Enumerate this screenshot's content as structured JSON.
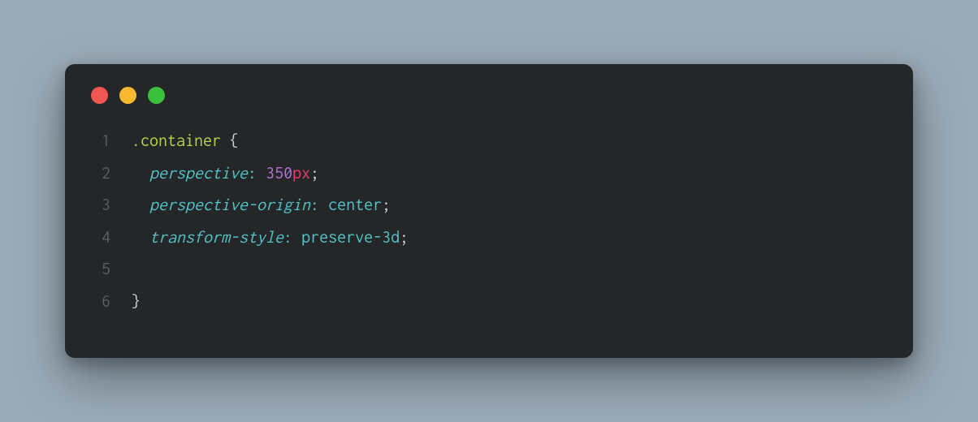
{
  "window": {
    "traffic_lights": {
      "red": "close",
      "yellow": "minimize",
      "green": "maximize"
    }
  },
  "code": {
    "language": "css",
    "lines": [
      {
        "n": "1",
        "tokens": [
          {
            "cls": "selector",
            "t": ".container"
          },
          {
            "cls": "plain",
            "t": " "
          },
          {
            "cls": "brace",
            "t": "{"
          }
        ]
      },
      {
        "n": "2",
        "tokens": [
          {
            "cls": "plain",
            "t": "  "
          },
          {
            "cls": "prop",
            "t": "perspective"
          },
          {
            "cls": "colon",
            "t": ":"
          },
          {
            "cls": "plain",
            "t": " "
          },
          {
            "cls": "num",
            "t": "350"
          },
          {
            "cls": "unit",
            "t": "px"
          },
          {
            "cls": "semi",
            "t": ";"
          }
        ]
      },
      {
        "n": "3",
        "tokens": [
          {
            "cls": "plain",
            "t": "  "
          },
          {
            "cls": "prop",
            "t": "perspective-origin"
          },
          {
            "cls": "colon",
            "t": ":"
          },
          {
            "cls": "plain",
            "t": " "
          },
          {
            "cls": "val",
            "t": "center"
          },
          {
            "cls": "semi",
            "t": ";"
          }
        ]
      },
      {
        "n": "4",
        "tokens": [
          {
            "cls": "plain",
            "t": "  "
          },
          {
            "cls": "prop",
            "t": "transform-style"
          },
          {
            "cls": "colon",
            "t": ":"
          },
          {
            "cls": "plain",
            "t": " "
          },
          {
            "cls": "val",
            "t": "preserve-3d"
          },
          {
            "cls": "semi",
            "t": ";"
          }
        ]
      },
      {
        "n": "5",
        "tokens": [
          {
            "cls": "plain",
            "t": ""
          }
        ]
      },
      {
        "n": "6",
        "tokens": [
          {
            "cls": "brace",
            "t": "}"
          }
        ]
      }
    ]
  }
}
